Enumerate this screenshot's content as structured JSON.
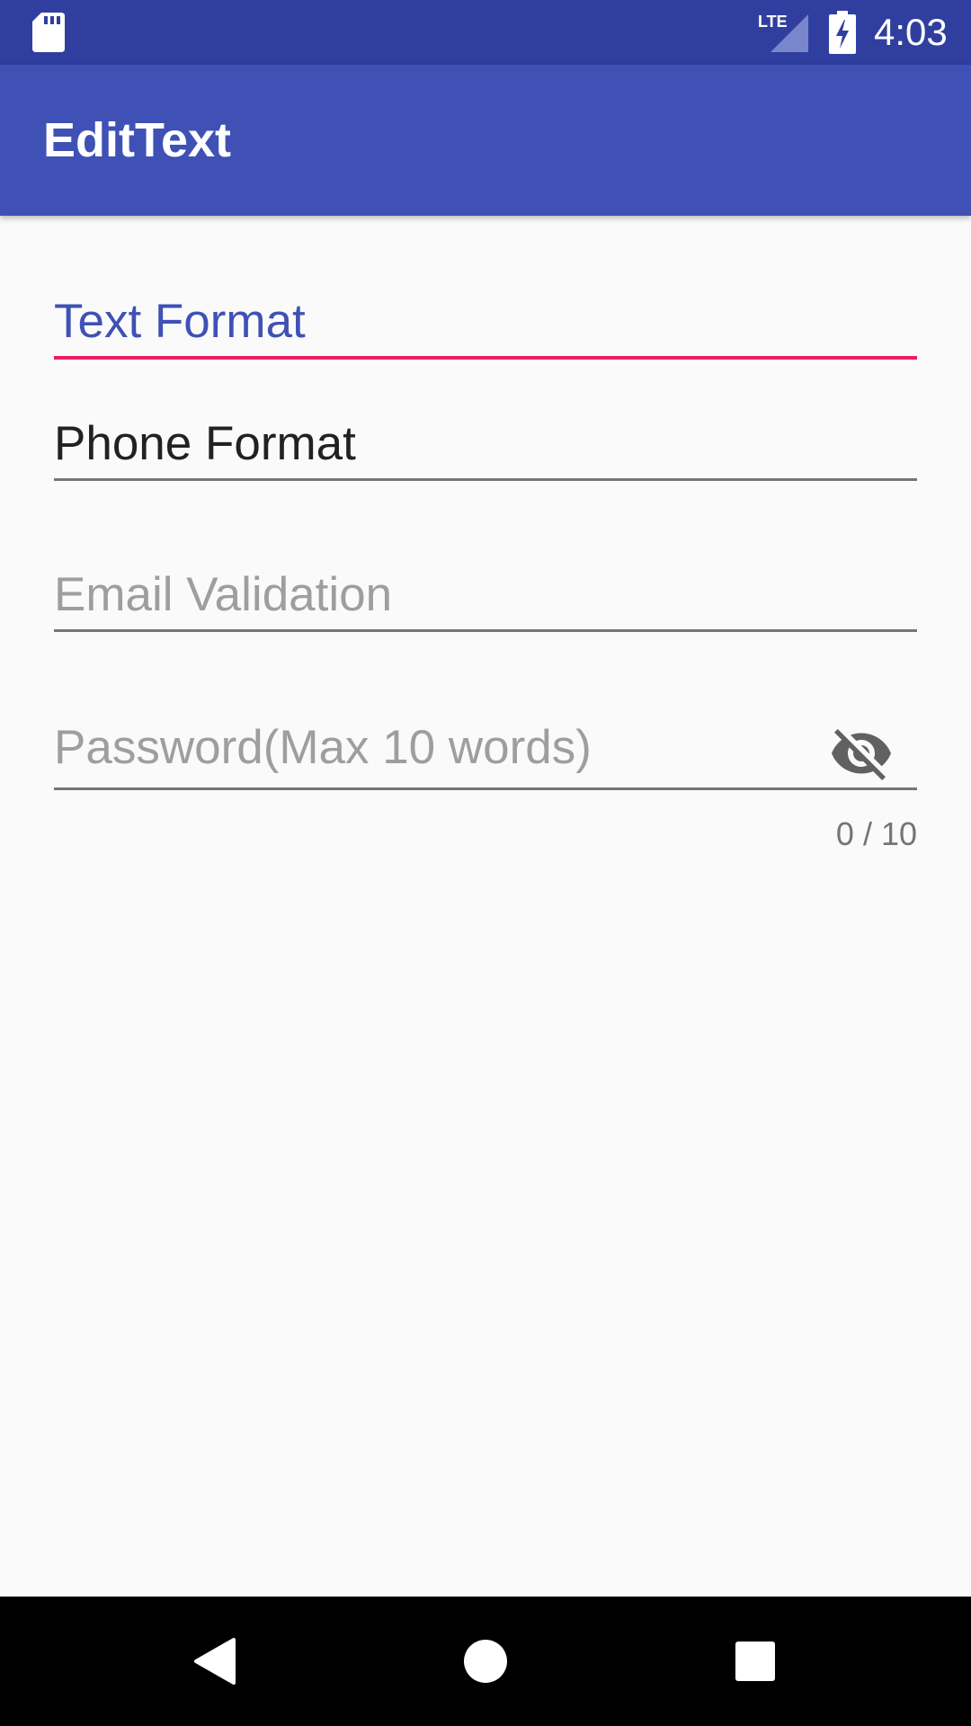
{
  "status_bar": {
    "time": "4:03",
    "network": "LTE",
    "icons": [
      "sd-card-icon",
      "signal-icon",
      "battery-charging-icon"
    ]
  },
  "app_bar": {
    "title": "EditText"
  },
  "form": {
    "text_format": {
      "value": "Text Format",
      "focused": true
    },
    "phone_format": {
      "value": "Phone Format"
    },
    "email_validation": {
      "placeholder": "Email Validation"
    },
    "password": {
      "placeholder": "Password(Max 10 words)",
      "toggle_icon": "eye-off-icon",
      "counter": "0 / 10"
    }
  },
  "nav_bar": {
    "icons": [
      "back-icon",
      "home-icon",
      "recents-icon"
    ]
  },
  "colors": {
    "status_bar": "#303f9f",
    "app_bar": "#3f51b5",
    "accent": "#e91e63",
    "focused_text": "#3f51b5",
    "hint_text": "#9e9e9e",
    "underline": "#757575",
    "background": "#fafafa"
  }
}
